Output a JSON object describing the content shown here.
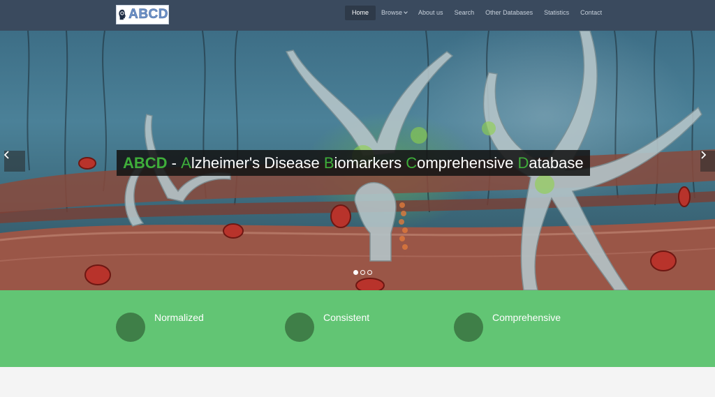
{
  "header": {
    "logo_text": "ABCD",
    "nav": [
      {
        "label": "Home",
        "active": true
      },
      {
        "label": "Browse",
        "dropdown": true
      },
      {
        "label": "About us"
      },
      {
        "label": "Search"
      },
      {
        "label": "Other Databases"
      },
      {
        "label": "Statistics"
      },
      {
        "label": "Contact"
      }
    ]
  },
  "hero": {
    "title_parts": [
      {
        "text": "ABCD",
        "green": true,
        "bold": true
      },
      {
        "text": " - ",
        "green": false
      },
      {
        "text": "A",
        "green": true
      },
      {
        "text": "lzheimer's Disease ",
        "green": false
      },
      {
        "text": "B",
        "green": true
      },
      {
        "text": "iomarkers ",
        "green": false
      },
      {
        "text": "C",
        "green": true
      },
      {
        "text": "omprehensive ",
        "green": false
      },
      {
        "text": "D",
        "green": true
      },
      {
        "text": "atabase",
        "green": false
      }
    ],
    "prev_icon": "chevron-left-icon",
    "next_icon": "chevron-right-icon",
    "slides_total": 3,
    "slide_active_index": 0
  },
  "features": [
    {
      "label": "Normalized"
    },
    {
      "label": "Consistent"
    },
    {
      "label": "Comprehensive"
    }
  ],
  "colors": {
    "navbar": "#3a4a5e",
    "accent_green": "#3fae3a",
    "feature_band": "#62c574",
    "feature_circle": "#3f7f48"
  }
}
